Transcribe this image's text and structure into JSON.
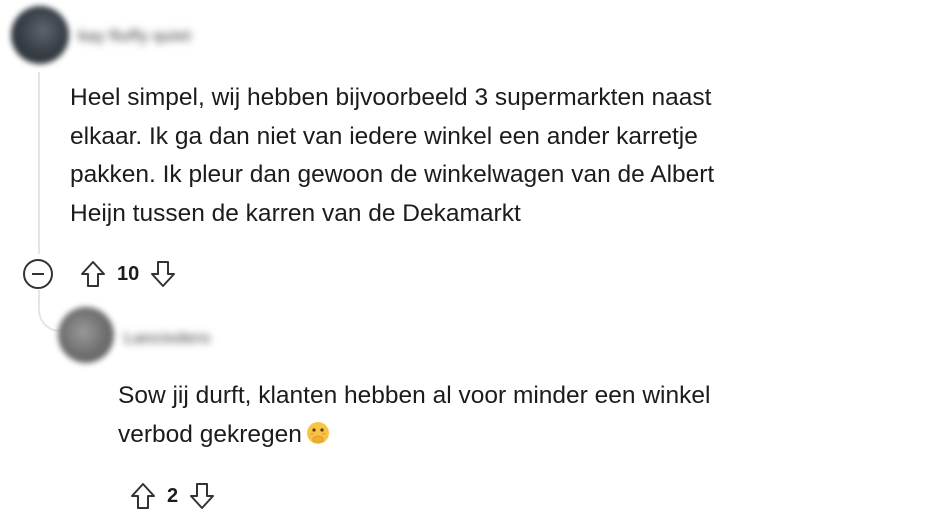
{
  "comments": [
    {
      "username": "kay fluffy quiet",
      "body_lines": [
        "Heel simpel, wij hebben bijvoorbeeld 3 supermarkten naast",
        "elkaar. Ik ga dan niet van iedere winkel een ander karretje",
        "pakken. Ik pleur dan gewoon de winkelwagen van de Albert",
        "Heijn tussen de karren van de Dekamarkt"
      ],
      "score": "10",
      "icons": {
        "collapse": "collapse-minus-icon",
        "upvote": "upvote-arrow-icon",
        "downvote": "downvote-arrow-icon"
      }
    },
    {
      "username": "Lanciodero",
      "body_lines": [
        "Sow jij durft, klanten hebben al voor minder een winkel",
        "verbod gekregen"
      ],
      "emoji": "face-with-hand-over-mouth-emoji",
      "score": "2",
      "icons": {
        "upvote": "upvote-arrow-icon",
        "downvote": "downvote-arrow-icon"
      }
    }
  ],
  "colors": {
    "text": "#1c1c1c",
    "thread_line": "#e5e5e5",
    "icon": "#333333"
  }
}
